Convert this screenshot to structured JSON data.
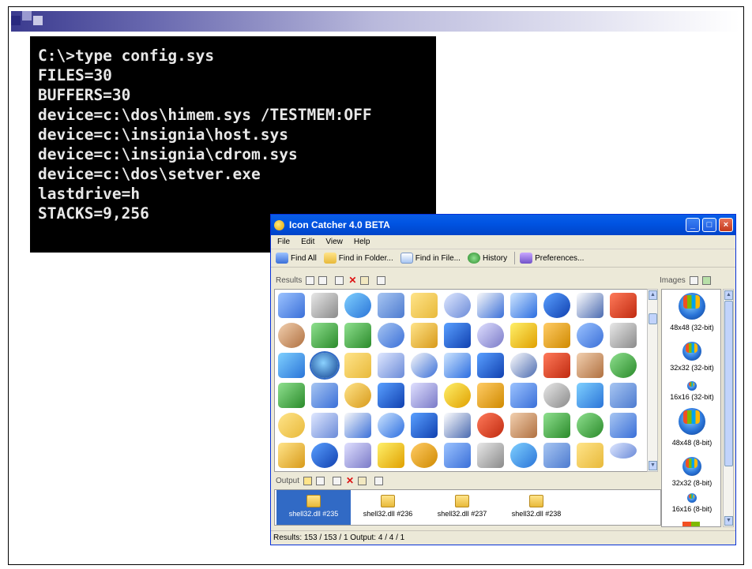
{
  "terminal": {
    "lines": [
      "C:\\>type config.sys",
      "FILES=30",
      "BUFFERS=30",
      "device=c:\\dos\\himem.sys /TESTMEM:OFF",
      "device=c:\\insignia\\host.sys",
      "device=c:\\insignia\\cdrom.sys",
      "device=c:\\dos\\setver.exe",
      "lastdrive=h",
      "STACKS=9,256"
    ]
  },
  "window": {
    "title": "Icon Catcher 4.0 BETA",
    "menu": [
      "File",
      "Edit",
      "View",
      "Help"
    ],
    "toolbar": {
      "find_all": "Find All",
      "find_in_folder": "Find in Folder...",
      "find_in_file": "Find in File...",
      "history": "History",
      "preferences": "Preferences..."
    },
    "results_label": "Results",
    "images_label": "Images",
    "output_label": "Output",
    "images": [
      "48x48 (32-bit)",
      "32x32 (32-bit)",
      "16x16 (32-bit)",
      "48x48 (8-bit)",
      "32x32 (8-bit)",
      "16x16 (8-bit)"
    ],
    "output_items": [
      "shell32.dll #235",
      "shell32.dll #236",
      "shell32.dll #237",
      "shell32.dll #238"
    ],
    "status": "Results: 153 / 153 / 1   Output: 4 / 4 / 1"
  },
  "colors": {
    "titlebar": "#0054e3",
    "selection": "#316ac5",
    "window_bg": "#ece9d8",
    "terminal_bg": "#000000"
  }
}
